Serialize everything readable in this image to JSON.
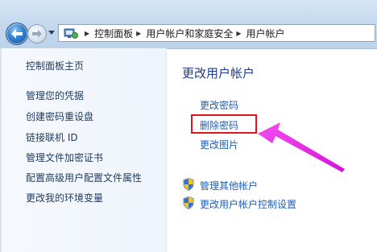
{
  "window": {
    "accent": "#bcd3ea"
  },
  "address_bar": {
    "crumbs": [
      "控制面板",
      "用户帐户和家庭安全",
      "用户帐户"
    ]
  },
  "left_nav": {
    "items": [
      "控制面板主页",
      "管理您的凭据",
      "创建密码重设盘",
      "链接联机 ID",
      "管理文件加密证书",
      "配置高级用户配置文件属性",
      "更改我的环境变量"
    ]
  },
  "main": {
    "title": "更改用户帐户",
    "tasks": [
      "更改密码",
      "删除密码",
      "更改图片"
    ],
    "highlighted_task": "删除密码",
    "admin_links": [
      "管理其他帐户",
      "更改用户帐户控制设置"
    ]
  },
  "annotation": {
    "highlight_color": "#e0141f",
    "arrow_color": "#e81fe6"
  },
  "icons": [
    "back-arrow-icon",
    "forward-arrow-icon",
    "dropdown-icon",
    "control-panel-icon",
    "chevron-right-icon",
    "uac-shield-icon"
  ]
}
